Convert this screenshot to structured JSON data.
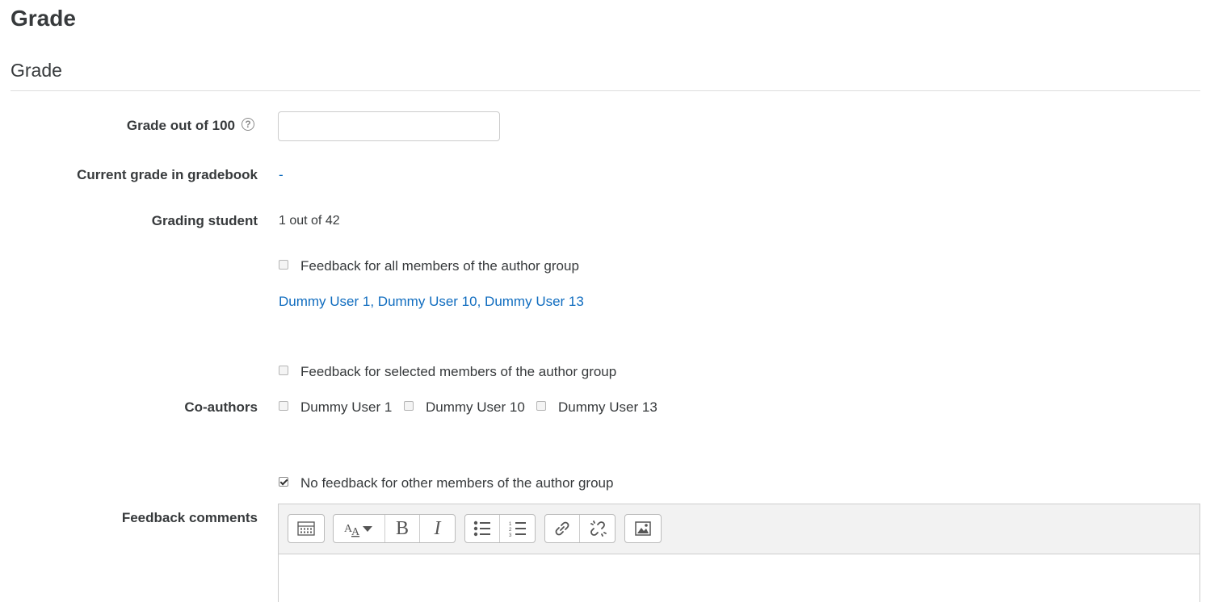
{
  "page": {
    "heading": "Grade",
    "section_heading": "Grade"
  },
  "form": {
    "grade_label": "Grade out of 100",
    "grade_help_icon": "question-circle-icon",
    "grade_value": "",
    "current_grade_label": "Current grade in gradebook",
    "current_grade_value": "-",
    "grading_student_label": "Grading student",
    "grading_student_value": "1 out of 42",
    "feedback_all_label": "Feedback for all members of the author group",
    "feedback_all_checked": false,
    "group_members_text": "Dummy User 1, Dummy User 10, Dummy User 13",
    "feedback_selected_label": "Feedback for selected members of the author group",
    "feedback_selected_checked": false,
    "coauthors_label": "Co-authors",
    "coauthors": [
      {
        "name": "Dummy User 1",
        "checked": false
      },
      {
        "name": "Dummy User 10",
        "checked": false
      },
      {
        "name": "Dummy User 13",
        "checked": false
      }
    ],
    "no_feedback_label": "No feedback for other members of the author group",
    "no_feedback_checked": true,
    "feedback_comments_label": "Feedback comments"
  },
  "editor": {
    "toolbar_icons": [
      [
        "toolbar-toggle-icon"
      ],
      [
        "font-style-icon",
        "bold-icon",
        "italic-icon"
      ],
      [
        "unordered-list-icon",
        "ordered-list-icon"
      ],
      [
        "link-icon",
        "unlink-icon"
      ],
      [
        "image-icon"
      ]
    ],
    "bold_glyph": "B",
    "italic_glyph": "I",
    "content": ""
  },
  "colors": {
    "link": "#0f6cbf",
    "text": "#373a3c",
    "toolbar_bg": "#f2f2f2"
  }
}
